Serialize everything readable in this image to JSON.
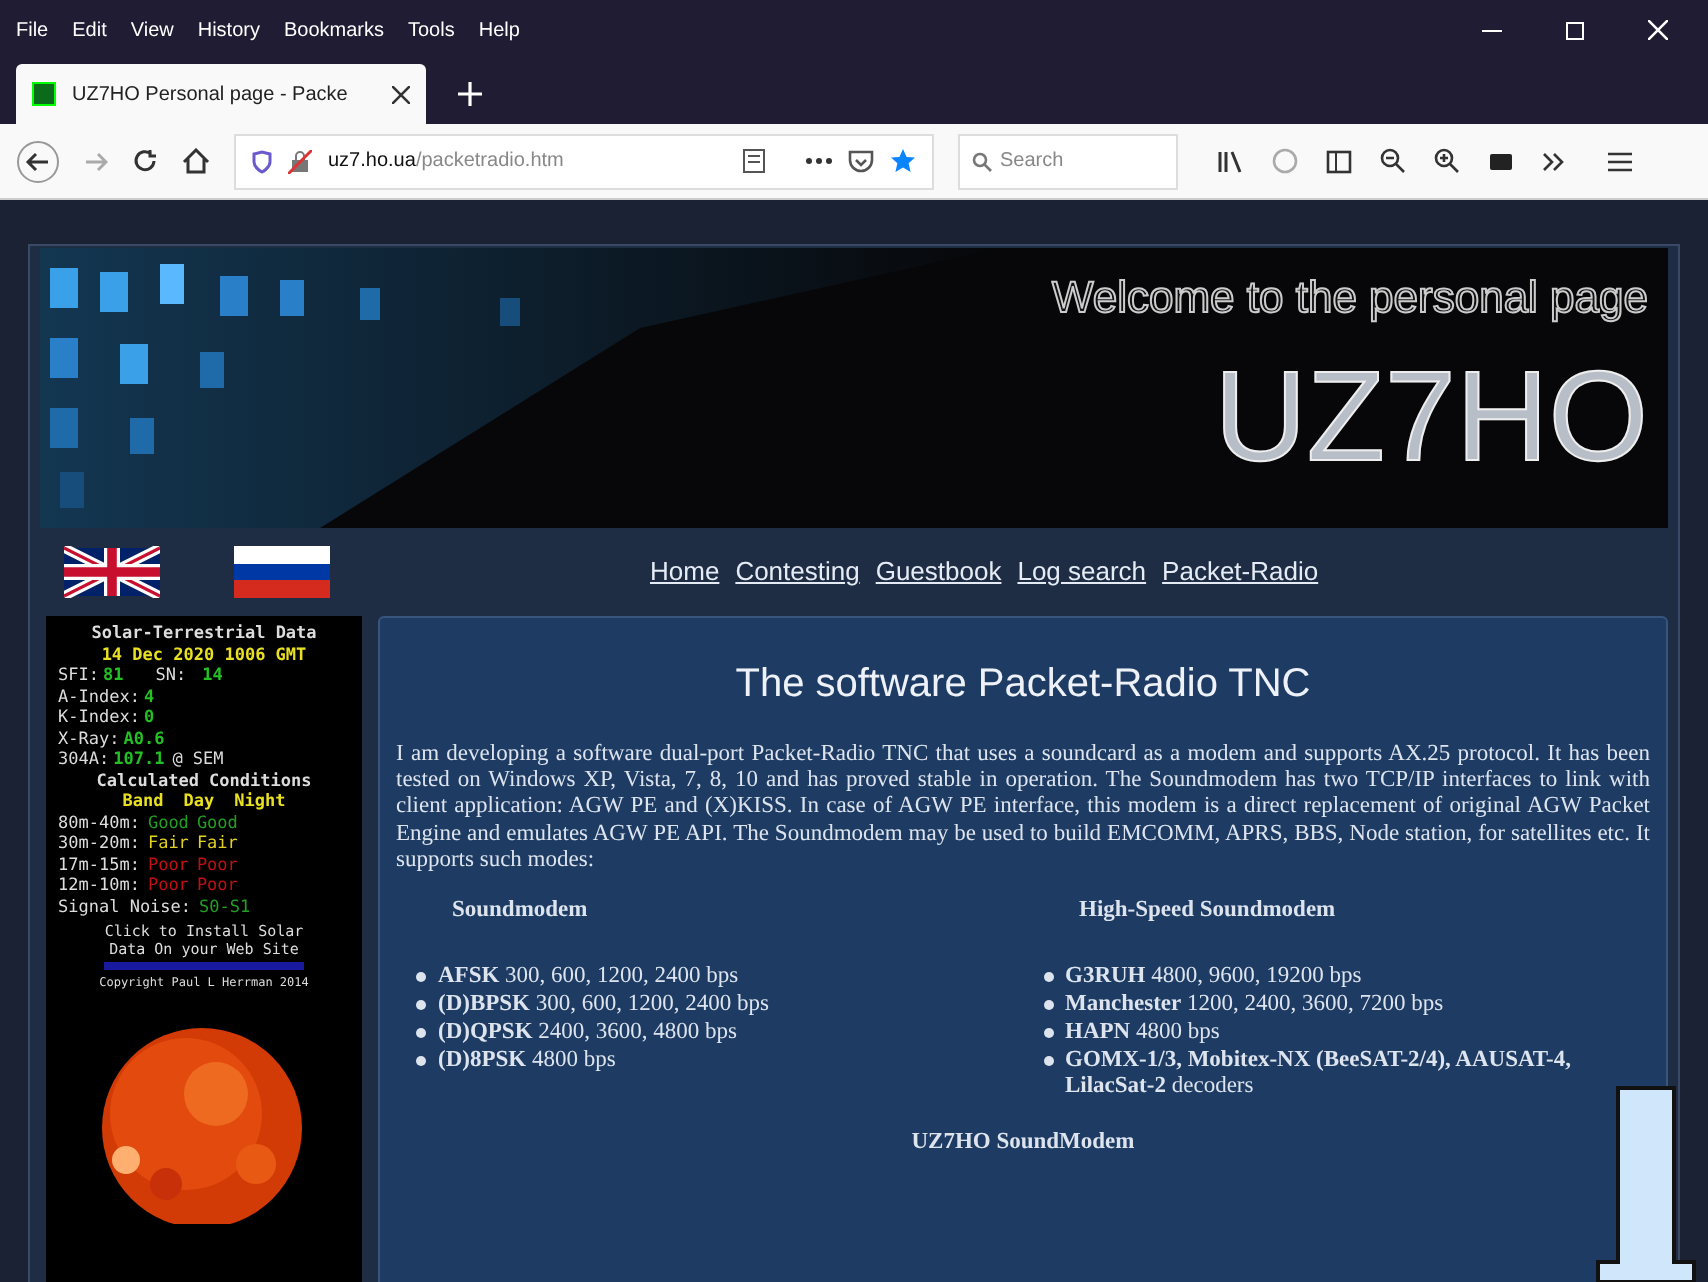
{
  "menu": [
    "File",
    "Edit",
    "View",
    "History",
    "Bookmarks",
    "Tools",
    "Help"
  ],
  "tab": {
    "title": "UZ7HO Personal page - Packe",
    "selected": true
  },
  "address": {
    "host": "uz7.ho.ua",
    "path": "/packetradio.htm"
  },
  "search": {
    "placeholder": "Search"
  },
  "banner": {
    "welcome": "Welcome to the personal page",
    "callsign": "UZ7HO"
  },
  "nav": [
    "Home",
    "Contesting",
    "Guestbook",
    "Log search",
    "Packet-Radio"
  ],
  "solar": {
    "title": "Solar-Terrestrial Data",
    "date": "14 Dec 2020 1006 GMT",
    "readings": [
      {
        "label": "SFI:",
        "value": "81",
        "label2": "SN:",
        "value2": "14"
      },
      {
        "label": "A-Index:",
        "value": "4"
      },
      {
        "label": "K-Index:",
        "value": "0"
      },
      {
        "label": "X-Ray:",
        "value": "A0.6"
      },
      {
        "label": "304A:",
        "value": "107.1",
        "suffix": "@ SEM"
      }
    ],
    "conditions_title": "Calculated Conditions",
    "header": [
      "Band",
      "Day",
      "Night"
    ],
    "conditions": [
      {
        "band": "80m-40m:",
        "day": "Good",
        "night": "Good",
        "color": "#22a022"
      },
      {
        "band": "30m-20m:",
        "day": "Fair",
        "night": "Fair",
        "color": "#e0d020"
      },
      {
        "band": "17m-15m:",
        "day": "Poor",
        "night": "Poor",
        "color": "#c01010"
      },
      {
        "band": "12m-10m:",
        "day": "Poor",
        "night": "Poor",
        "color": "#c01010"
      }
    ],
    "noise_label": "Signal Noise:",
    "noise_value": "S0-S1",
    "install": "Click to Install Solar Data On your Web Site",
    "copyright": "Copyright Paul L Herrman 2014"
  },
  "article": {
    "title": "The software Packet-Radio TNC",
    "intro": "I am developing a software dual-port Packet-Radio TNC that uses a soundcard as a modem and supports AX.25 protocol. It has been tested on Windows XP, Vista, 7, 8, 10 and has proved stable in operation. The Soundmodem has two TCP/IP interfaces to link with client application: AGW PE and (X)KISS. In case of AGW PE interface, this modem is a direct replacement of original AGW Packet Engine and emulates AGW PE API. The Soundmodem may be used to build EMCOMM, APRS, BBS, Node station, for satellites etc. It supports such modes:",
    "columns": [
      {
        "heading": "Soundmodem",
        "items": [
          "**AFSK** 300, 600, 1200, 2400 bps",
          "**(D)BPSK** 300, 600, 1200, 2400 bps",
          "**(D)QPSK** 2400, 3600, 4800 bps",
          "**(D)8PSK** 4800 bps"
        ]
      },
      {
        "heading": "High-Speed Soundmodem",
        "items": [
          "**G3RUH** 4800, 9600, 19200 bps",
          "**Manchester** 1200, 2400, 3600, 7200 bps",
          "**HAPN** 4800 bps",
          "**GOMX-1/3, Mobitex-NX (BeeSAT-2/4), AAUSAT-4, LilacSat-2** decoders"
        ]
      }
    ],
    "footer": "UZ7HO SoundModem"
  }
}
